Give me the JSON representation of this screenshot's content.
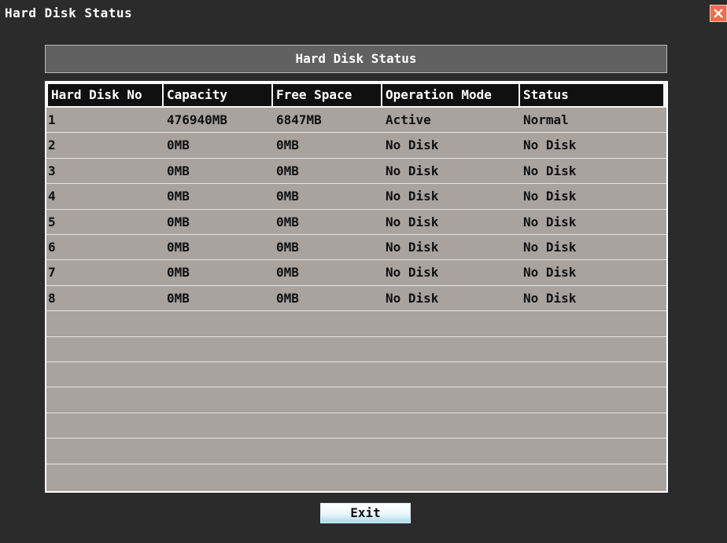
{
  "window": {
    "title": "Hard Disk Status",
    "close_icon": "close-icon"
  },
  "panel": {
    "title": "Hard Disk Status"
  },
  "table": {
    "columns": [
      "Hard Disk No",
      "Capacity",
      "Free Space",
      "Operation Mode",
      "Status"
    ],
    "rows": [
      [
        "1",
        "476940MB",
        "6847MB",
        "Active",
        "Normal"
      ],
      [
        "2",
        "0MB",
        "0MB",
        "No Disk",
        "No Disk"
      ],
      [
        "3",
        "0MB",
        "0MB",
        "No Disk",
        "No Disk"
      ],
      [
        "4",
        "0MB",
        "0MB",
        "No Disk",
        "No Disk"
      ],
      [
        "5",
        "0MB",
        "0MB",
        "No Disk",
        "No Disk"
      ],
      [
        "6",
        "0MB",
        "0MB",
        "No Disk",
        "No Disk"
      ],
      [
        "7",
        "0MB",
        "0MB",
        "No Disk",
        "No Disk"
      ],
      [
        "8",
        "0MB",
        "0MB",
        "No Disk",
        "No Disk"
      ]
    ]
  },
  "buttons": {
    "exit_label": "Exit"
  }
}
